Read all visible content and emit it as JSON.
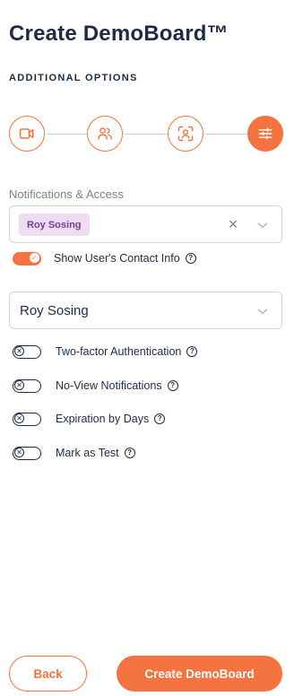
{
  "page": {
    "title": "Create DemoBoard™",
    "section_heading": "ADDITIONAL OPTIONS"
  },
  "stepper": {
    "steps": [
      {
        "icon": "video-camera-icon",
        "state": "completed"
      },
      {
        "icon": "users-icon",
        "state": "completed"
      },
      {
        "icon": "face-scan-icon",
        "state": "completed"
      },
      {
        "icon": "sliders-icon",
        "state": "active"
      }
    ],
    "accent": "#f47340"
  },
  "notifications": {
    "label": "Notifications & Access",
    "selected_chips": [
      "Roy Sosing"
    ],
    "clear_symbol": "×",
    "show_contact": {
      "label": "Show User's Contact Info",
      "on": true
    }
  },
  "user_select": {
    "value": "Roy Sosing"
  },
  "options": [
    {
      "key": "two_factor",
      "label": "Two-factor Authentication",
      "on": false
    },
    {
      "key": "no_view",
      "label": "No-View Notifications",
      "on": false
    },
    {
      "key": "expiration",
      "label": "Expiration by Days",
      "on": false
    },
    {
      "key": "mark_test",
      "label": "Mark as Test",
      "on": false
    }
  ],
  "footer": {
    "back_label": "Back",
    "create_label": "Create DemoBoard"
  },
  "colors": {
    "accent": "#f47340",
    "text": "#1f2a44",
    "chip_bg": "#efdcf3",
    "chip_text": "#7a3b8e"
  }
}
